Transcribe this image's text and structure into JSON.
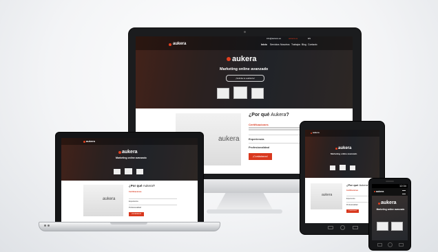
{
  "brand": {
    "name": "aukera",
    "tagline": "Marketing online avanzado",
    "cta": "¡Solicita tu auditoría!"
  },
  "top_bar": {
    "email": "info@aukera.es",
    "phone": "aukera.es",
    "lang": "ES"
  },
  "nav": {
    "items": [
      "Inicio",
      "Servicios",
      "Nosotros",
      "Trabajos",
      "Blog",
      "Contacto"
    ]
  },
  "section": {
    "title_prefix": "¿Por qué ",
    "title_brand": "Aukera",
    "title_suffix": "?",
    "items": [
      {
        "label": "Certificaciones"
      },
      {
        "label": "Experiencia"
      },
      {
        "label": "Profesionalidad"
      }
    ],
    "button": "¡Contáctanos!"
  },
  "phone": {
    "time": "12:34"
  },
  "colors": {
    "accent": "#d9381e",
    "dark": "#2b2e33"
  }
}
